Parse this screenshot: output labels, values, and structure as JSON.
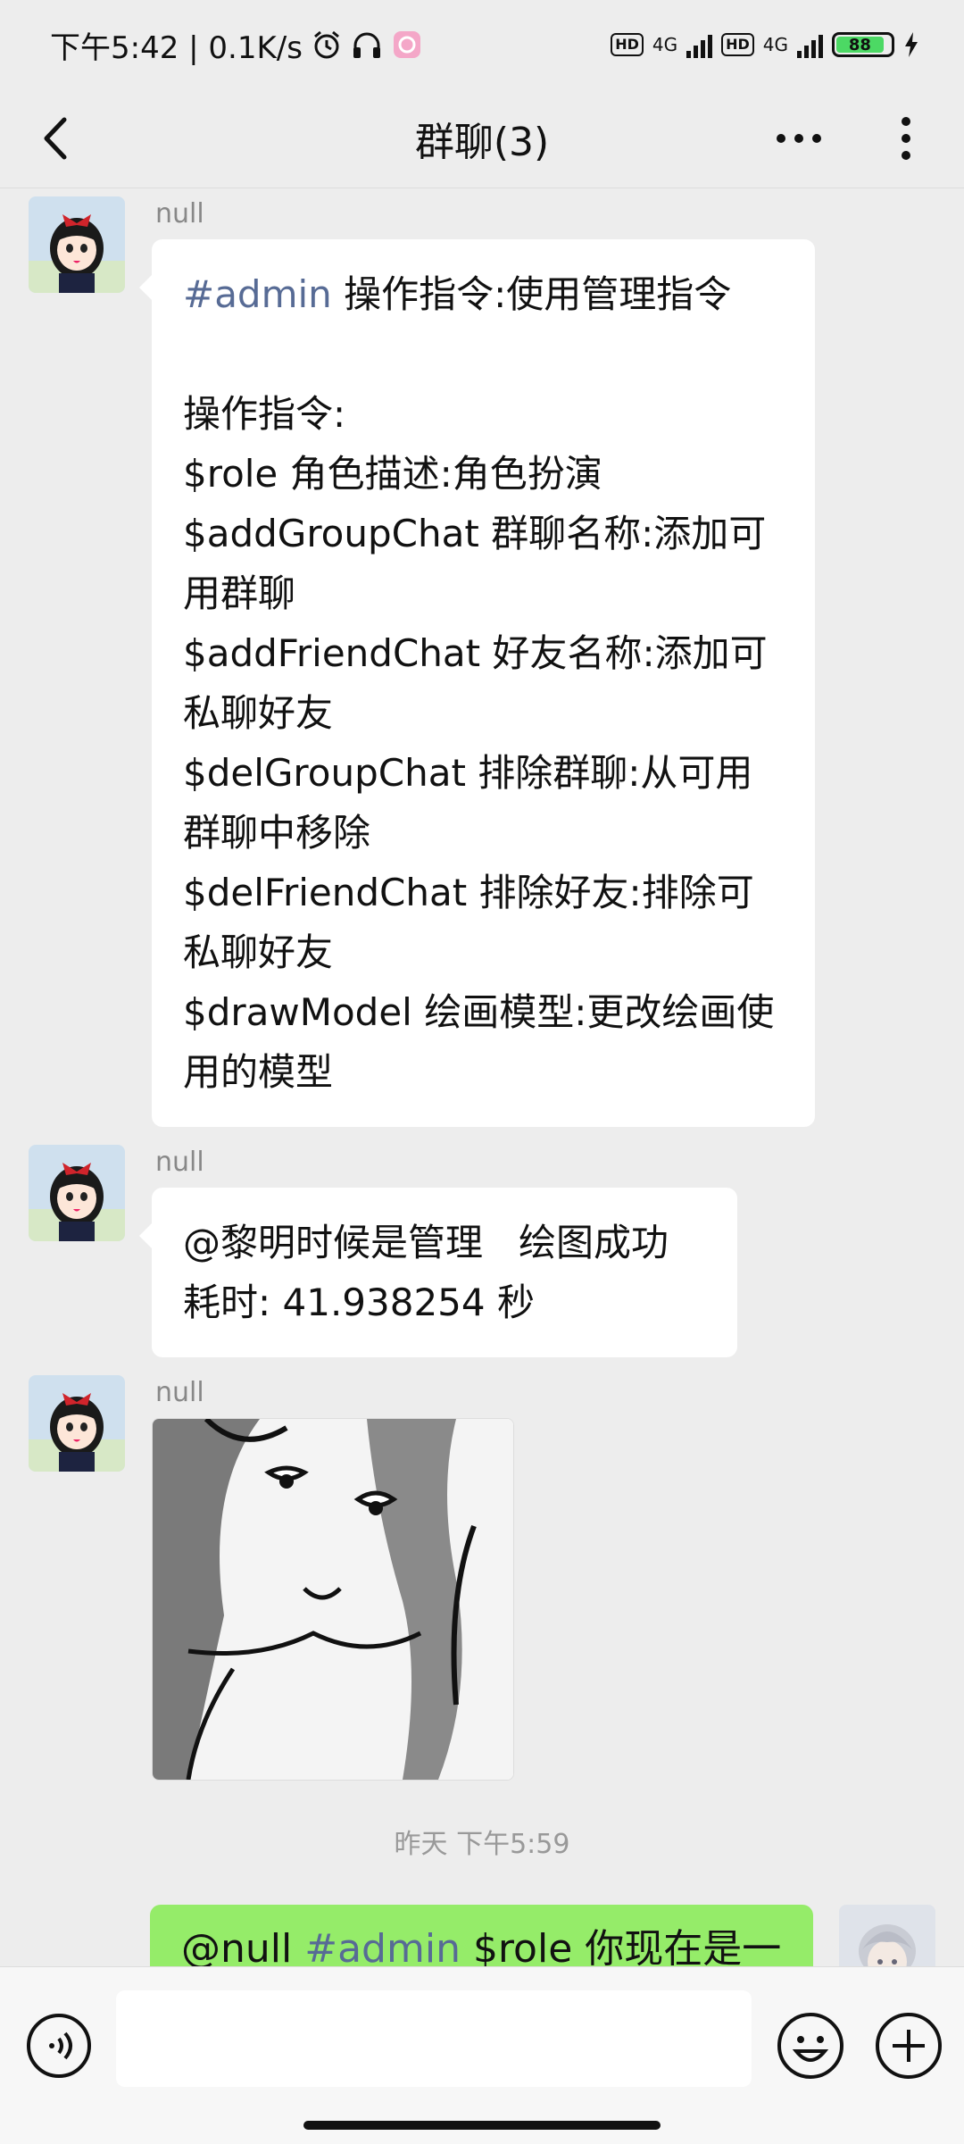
{
  "status_bar": {
    "time_speed": "下午5:42 | 0.1K/s",
    "hd1": "HD",
    "net1": "4G",
    "hd2": "HD",
    "net2": "4G",
    "battery": "88"
  },
  "header": {
    "title": "群聊(3)"
  },
  "messages": [
    {
      "sender": "null",
      "tag": "#admin",
      "text_after_tag": " 操作指令:使用管理指令\n\n操作指令:\n$role 角色描述:角色扮演\n$addGroupChat 群聊名称:添加可用群聊\n$addFriendChat 好友名称:添加可私聊好友\n$delGroupChat 排除群聊:从可用群聊中移除\n$delFriendChat 排除好友:排除可私聊好友\n$drawModel 绘画模型:更改绘画使用的模型"
    },
    {
      "sender": "null",
      "text": "@黎明时候是管理   绘图成功\n耗时: 41.938254 秒"
    },
    {
      "sender": "null"
    }
  ],
  "timestamp": "昨天 下午5:59",
  "self_message": {
    "mention": "@null",
    "tag": " #admin",
    "text": " $role 你现在是一"
  },
  "colors": {
    "background": "#ededed",
    "self_bubble": "#95ec69",
    "tag": "#576b95"
  }
}
